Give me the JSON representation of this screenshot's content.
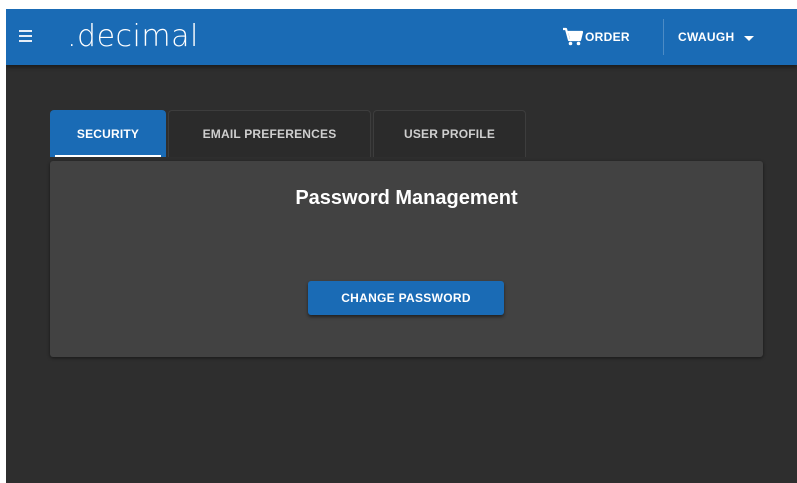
{
  "colors": {
    "brand": "#1a6bb5",
    "background": "#2e2e2e",
    "panel": "#424242",
    "text": "#ffffff"
  },
  "appbar": {
    "menu_icon": "hamburger-menu-icon",
    "brand": ".decimal",
    "order_icon": "shopping-cart-icon",
    "order_label": "ORDER",
    "user_label": "CWAUGH",
    "user_caret_icon": "caret-down-icon"
  },
  "tabs": [
    {
      "label": "SECURITY",
      "active": true
    },
    {
      "label": "EMAIL PREFERENCES",
      "active": false
    },
    {
      "label": "USER PROFILE",
      "active": false
    }
  ],
  "panel": {
    "title": "Password Management",
    "button_label": "CHANGE PASSWORD"
  }
}
